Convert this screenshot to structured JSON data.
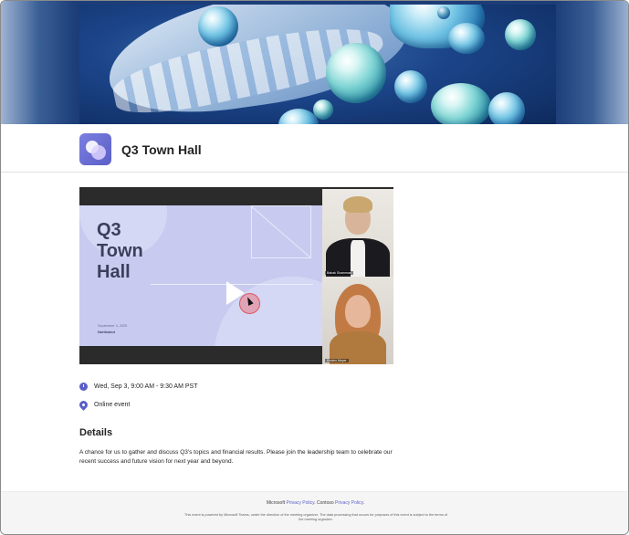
{
  "event": {
    "title": "Q3 Town Hall",
    "datetime": "Wed, Sep 3, 9:00 AM - 9:30 AM PST",
    "location": "Online event"
  },
  "slide": {
    "title": "Q3\nTown\nHall",
    "date": "September 3, 2025",
    "org": "Northwind"
  },
  "participants": [
    {
      "name": "Babak Shammas"
    },
    {
      "name": "Kirsten Meyer"
    }
  ],
  "details": {
    "heading": "Details",
    "body": "A chance for us to gather and discuss Q3's topics and financial results. Please join the leadership team to celebrate our recent success and future vision for next year and beyond."
  },
  "footer": {
    "microsoft": "Microsoft",
    "microsoft_policy": "Privacy Policy",
    "separator": ". Contoso",
    "contoso_policy": "Privacy Policy",
    "end": ".",
    "note": "This event is powered by Microsoft Teams, under the direction of the meeting organizer. The data processing that occurs for purposes of this event is subject to the terms of the meeting organizer."
  },
  "colors": {
    "accent": "#5b5fc7",
    "slide_background": "#c8cbef"
  }
}
